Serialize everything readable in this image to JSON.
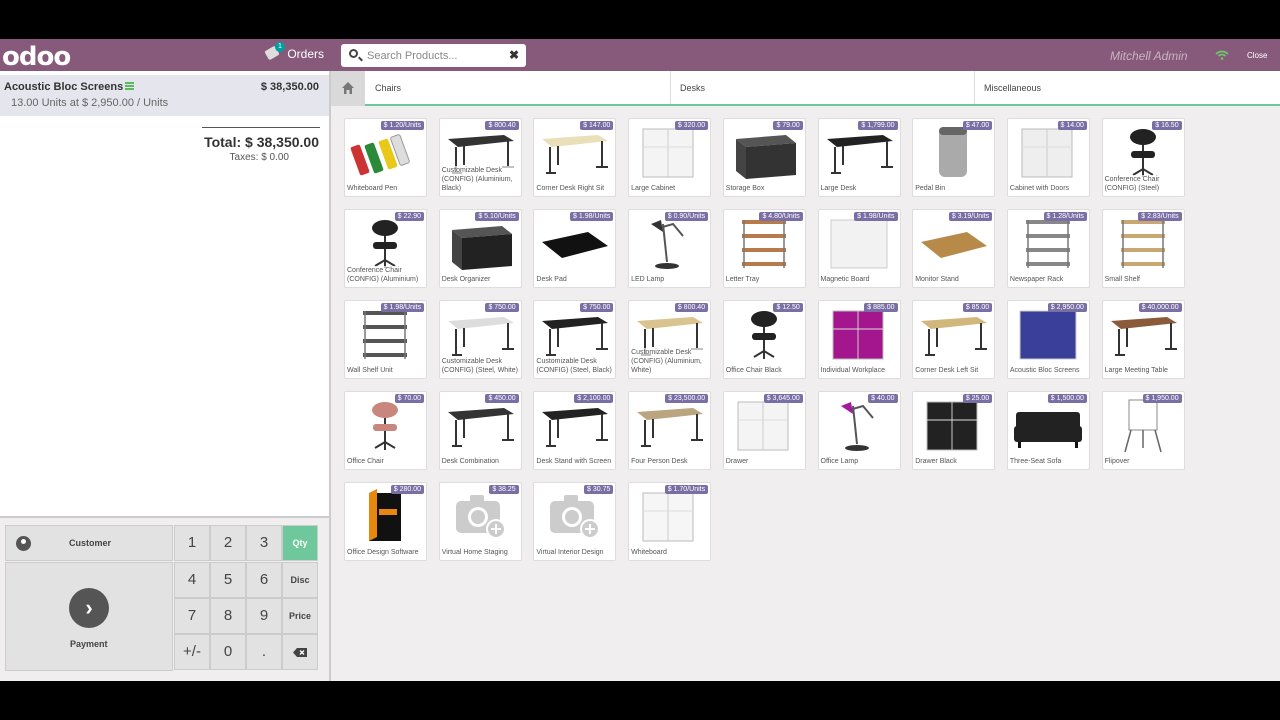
{
  "header": {
    "logo": "odoo",
    "orders_label": "Orders",
    "orders_count": "1",
    "search_placeholder": "Search Products...",
    "user": "Mitchell Admin",
    "close_label": "Close"
  },
  "order": {
    "line_name": "Acoustic Bloc Screens",
    "line_price": "$ 38,350.00",
    "line_qty": "13.00",
    "line_detail": "Units at $ 2,950.00 / Units",
    "total": "Total: $ 38,350.00",
    "taxes": "Taxes: $ 0.00"
  },
  "pad": {
    "customer": "Customer",
    "payment": "Payment",
    "keys": [
      "1",
      "2",
      "3",
      "Qty",
      "4",
      "5",
      "6",
      "Disc",
      "7",
      "8",
      "9",
      "Price",
      "+/-",
      "0",
      "."
    ]
  },
  "categories": [
    "Chairs",
    "Desks",
    "Miscellaneous"
  ],
  "products": [
    {
      "name": "Whiteboard Pen",
      "price": "$ 1.20/Units",
      "kind": "pens",
      "color": "#c33"
    },
    {
      "name": "Customizable Desk (CONFIG) (Aluminium, Black)",
      "price": "$ 800.40",
      "kind": "desk",
      "color": "#333"
    },
    {
      "name": "Corner Desk Right Sit",
      "price": "$ 147.00",
      "kind": "desk",
      "color": "#e9dfb8"
    },
    {
      "name": "Large Cabinet",
      "price": "$ 320.00",
      "kind": "cabinet",
      "color": "#f4f4f4"
    },
    {
      "name": "Storage Box",
      "price": "$ 79.00",
      "kind": "box",
      "color": "#333"
    },
    {
      "name": "Large Desk",
      "price": "$ 1,799.00",
      "kind": "desk",
      "color": "#222"
    },
    {
      "name": "Pedal Bin",
      "price": "$ 47.00",
      "kind": "bin",
      "color": "#aaa"
    },
    {
      "name": "Cabinet with Doors",
      "price": "$ 14.00",
      "kind": "cabinet",
      "color": "#eee"
    },
    {
      "name": "Conference Chair (CONFIG) (Steel)",
      "price": "$ 16.50",
      "kind": "chair",
      "color": "#222"
    },
    {
      "name": "Conference Chair (CONFIG) (Aluminium)",
      "price": "$ 22.90",
      "kind": "chair",
      "color": "#222"
    },
    {
      "name": "Desk Organizer",
      "price": "$ 5.10/Units",
      "kind": "box",
      "color": "#222"
    },
    {
      "name": "Desk Pad",
      "price": "$ 1.98/Units",
      "kind": "pad",
      "color": "#111"
    },
    {
      "name": "LED Lamp",
      "price": "$ 0.90/Units",
      "kind": "lamp",
      "color": "#333"
    },
    {
      "name": "Letter Tray",
      "price": "$ 4.80/Units",
      "kind": "shelf",
      "color": "#b97a4a"
    },
    {
      "name": "Magnetic Board",
      "price": "$ 1.98/Units",
      "kind": "board",
      "color": "#f2f2f2"
    },
    {
      "name": "Monitor Stand",
      "price": "$ 3.19/Units",
      "kind": "pad",
      "color": "#b88a4a"
    },
    {
      "name": "Newspaper Rack",
      "price": "$ 1.28/Units",
      "kind": "shelf",
      "color": "#888"
    },
    {
      "name": "Small Shelf",
      "price": "$ 2.83/Units",
      "kind": "shelf",
      "color": "#c9a773"
    },
    {
      "name": "Wall Shelf Unit",
      "price": "$ 1.98/Units",
      "kind": "shelf",
      "color": "#555"
    },
    {
      "name": "Customizable Desk (CONFIG) (Steel, White)",
      "price": "$ 750.00",
      "kind": "desk",
      "color": "#ddd"
    },
    {
      "name": "Customizable Desk (CONFIG) (Steel, Black)",
      "price": "$ 750.00",
      "kind": "desk",
      "color": "#222"
    },
    {
      "name": "Customizable Desk (CONFIG) (Aluminium, White)",
      "price": "$ 800.40",
      "kind": "desk",
      "color": "#d9c38f"
    },
    {
      "name": "Office Chair Black",
      "price": "$ 12.50",
      "kind": "chair",
      "color": "#222"
    },
    {
      "name": "Individual Workplace",
      "price": "$ 885.00",
      "kind": "cabinet",
      "color": "#a3168e"
    },
    {
      "name": "Corner Desk Left Sit",
      "price": "$ 85.00",
      "kind": "desk",
      "color": "#d2b77d"
    },
    {
      "name": "Acoustic Bloc Screens",
      "price": "$ 2,950.00",
      "kind": "board",
      "color": "#3a3f9a"
    },
    {
      "name": "Large Meeting Table",
      "price": "$ 40,000.00",
      "kind": "desk",
      "color": "#8a5a3a"
    },
    {
      "name": "Office Chair",
      "price": "$ 70.00",
      "kind": "chair",
      "color": "#c9867c"
    },
    {
      "name": "Desk Combination",
      "price": "$ 450.00",
      "kind": "desk",
      "color": "#333"
    },
    {
      "name": "Desk Stand with Screen",
      "price": "$ 2,100.00",
      "kind": "desk",
      "color": "#222"
    },
    {
      "name": "Four Person Desk",
      "price": "$ 23,500.00",
      "kind": "desk",
      "color": "#bba580"
    },
    {
      "name": "Drawer",
      "price": "$ 3,645.00",
      "kind": "cabinet",
      "color": "#f4f4f4"
    },
    {
      "name": "Office Lamp",
      "price": "$ 40.00",
      "kind": "lamp",
      "color": "#a31b9a"
    },
    {
      "name": "Drawer Black",
      "price": "$ 25.00",
      "kind": "cabinet",
      "color": "#222"
    },
    {
      "name": "Three-Seat Sofa",
      "price": "$ 1,500.00",
      "kind": "sofa",
      "color": "#222"
    },
    {
      "name": "Flipover",
      "price": "$ 1,950.00",
      "kind": "flip",
      "color": "#eee"
    },
    {
      "name": "Office Design Software",
      "price": "$ 280.00",
      "kind": "software",
      "color": "#e8870e"
    },
    {
      "name": "Virtual Home Staging",
      "price": "$ 38.25",
      "kind": "camera",
      "color": "#ccc"
    },
    {
      "name": "Virtual Interior Design",
      "price": "$ 30.75",
      "kind": "camera",
      "color": "#ccc"
    },
    {
      "name": "Whiteboard",
      "price": "$ 1.70/Units",
      "kind": "cabinet",
      "color": "#f6f6f6"
    }
  ],
  "colors": {
    "brand": "#875a7b",
    "accent": "#6ec89b",
    "price_tag": "#7a6fa5"
  }
}
